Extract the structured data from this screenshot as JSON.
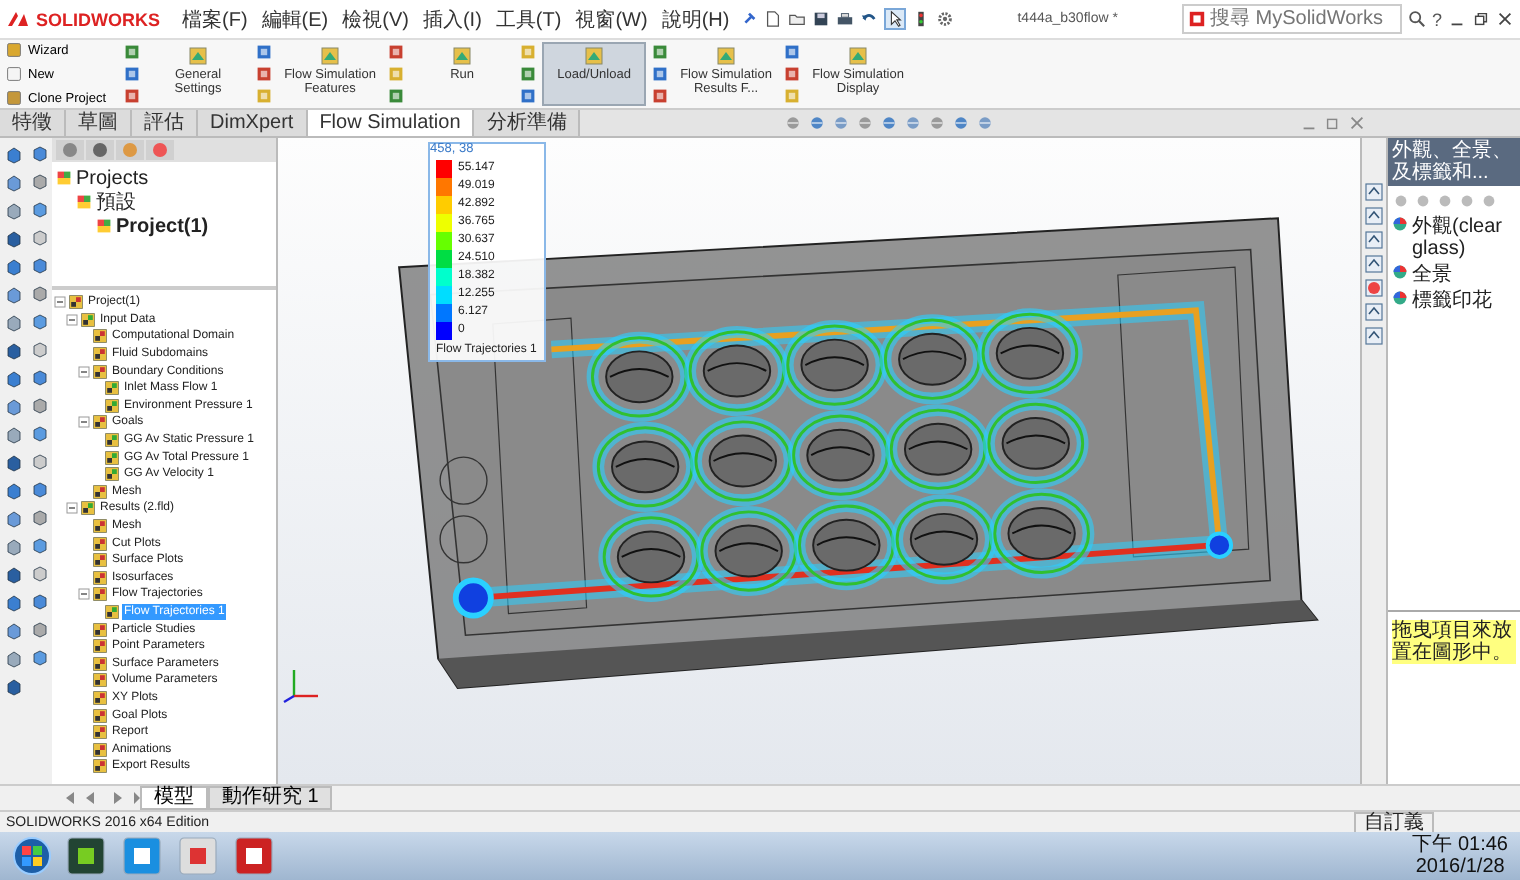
{
  "app": {
    "logo": "SOLIDWORKS",
    "menus": [
      "檔案(F)",
      "編輯(E)",
      "檢視(V)",
      "插入(I)",
      "工具(T)",
      "視窗(W)",
      "說明(H)"
    ],
    "title": "t444a_b30flow *",
    "search": {
      "placeholder": "搜尋 MySolidWorks"
    },
    "help": "?"
  },
  "ribbon": {
    "small_buttons": [
      {
        "label": "Wizard"
      },
      {
        "label": "New"
      },
      {
        "label": "Clone Project"
      }
    ],
    "large_buttons": [
      {
        "label": "General Settings",
        "selected": false
      },
      {
        "label": "Flow Simulation Features",
        "selected": false
      },
      {
        "label": "Run",
        "selected": false
      },
      {
        "label": "Load/Unload",
        "selected": true
      },
      {
        "label": "Flow Simulation Results F...",
        "selected": false
      },
      {
        "label": "Flow Simulation Display",
        "selected": false
      }
    ]
  },
  "tabs": [
    {
      "label": "特徵",
      "selected": false
    },
    {
      "label": "草圖",
      "selected": false
    },
    {
      "label": "評估",
      "selected": false
    },
    {
      "label": "DimXpert",
      "selected": false
    },
    {
      "label": "Flow Simulation",
      "selected": true
    },
    {
      "label": "分析準備",
      "selected": false
    }
  ],
  "projects_tree": [
    {
      "label": "Projects",
      "active": false,
      "children": [
        {
          "label": "預設",
          "active": false,
          "children": [
            {
              "label": "Project(1)",
              "active": true
            }
          ]
        }
      ]
    }
  ],
  "tree": [
    {
      "label": "Project(1)",
      "selected": false,
      "children": [
        {
          "label": "Input Data",
          "selected": false,
          "children": [
            {
              "label": "Computational Domain",
              "selected": false
            },
            {
              "label": "Fluid Subdomains",
              "selected": false
            },
            {
              "label": "Boundary Conditions",
              "selected": false,
              "children": [
                {
                  "label": "Inlet Mass Flow 1",
                  "selected": false
                },
                {
                  "label": "Environment Pressure 1",
                  "selected": false
                }
              ]
            },
            {
              "label": "Goals",
              "selected": false,
              "children": [
                {
                  "label": "GG Av Static Pressure 1",
                  "selected": false
                },
                {
                  "label": "GG Av Total Pressure 1",
                  "selected": false
                },
                {
                  "label": "GG Av Velocity 1",
                  "selected": false
                }
              ]
            },
            {
              "label": "Mesh",
              "selected": false
            }
          ]
        },
        {
          "label": "Results (2.fld)",
          "selected": false,
          "children": [
            {
              "label": "Mesh",
              "selected": false
            },
            {
              "label": "Cut Plots",
              "selected": false
            },
            {
              "label": "Surface Plots",
              "selected": false
            },
            {
              "label": "Isosurfaces",
              "selected": false
            },
            {
              "label": "Flow Trajectories",
              "selected": false,
              "children": [
                {
                  "label": "Flow Trajectories 1",
                  "selected": true
                }
              ]
            },
            {
              "label": "Particle Studies",
              "selected": false
            },
            {
              "label": "Point Parameters",
              "selected": false
            },
            {
              "label": "Surface Parameters",
              "selected": false
            },
            {
              "label": "Volume Parameters",
              "selected": false
            },
            {
              "label": "XY Plots",
              "selected": false
            },
            {
              "label": "Goal Plots",
              "selected": false
            },
            {
              "label": "Report",
              "selected": false
            },
            {
              "label": "Animations",
              "selected": false
            },
            {
              "label": "Export Results",
              "selected": false
            }
          ]
        }
      ]
    }
  ],
  "legend": {
    "caption": "458, 38",
    "values": [
      "55.147",
      "49.019",
      "42.892",
      "36.765",
      "30.637",
      "24.510",
      "18.382",
      "12.255",
      "6.127",
      "0"
    ],
    "label": "Flow Trajectories 1"
  },
  "task_pane": {
    "title": "外觀、全景、及標籤和...",
    "items": [
      "外觀(clear glass)",
      "全景",
      "標籤印花"
    ],
    "hint": "拖曳項目來放置在圖形中。"
  },
  "model_tabs": [
    {
      "label": "模型",
      "selected": true
    },
    {
      "label": "動作研究 1",
      "selected": false
    }
  ],
  "status": {
    "edition": "SOLIDWORKS 2016 x64 Edition",
    "units": "自訂義"
  },
  "taskbar": {
    "time": "下午 01:46",
    "date": "2016/1/28"
  }
}
